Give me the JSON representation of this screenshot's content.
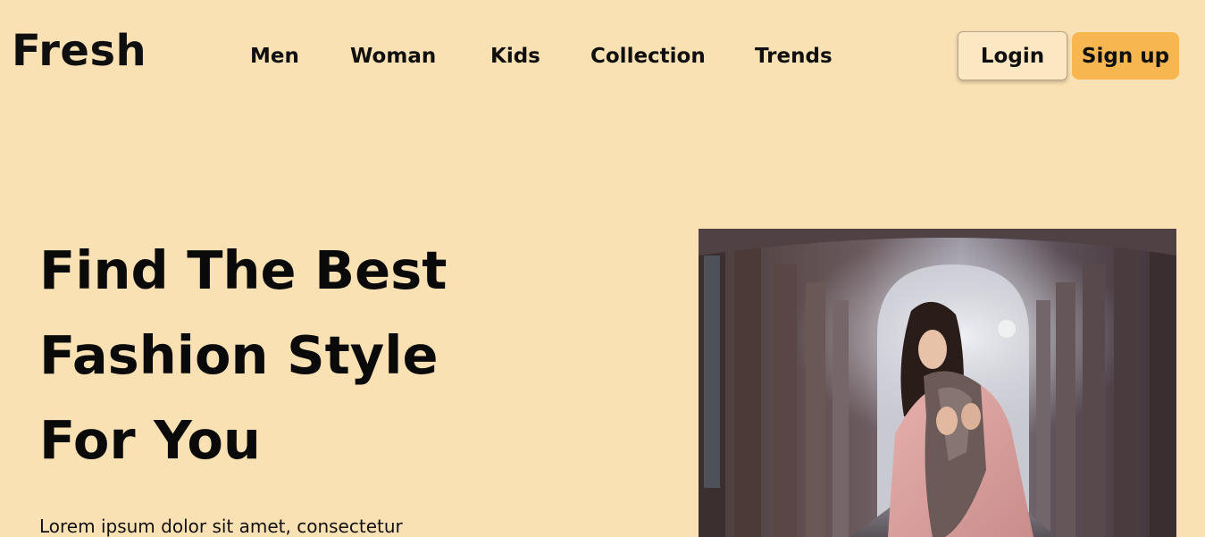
{
  "header": {
    "brand": "Fresh",
    "nav": {
      "men": "Men",
      "woman": "Woman",
      "kids": "Kids",
      "collection": "Collection",
      "trends": "Trends"
    },
    "login_label": "Login",
    "signup_label": "Sign up"
  },
  "hero": {
    "title_lines": [
      "Find The Best",
      "Fashion Style",
      "For You"
    ],
    "description": "Lorem ipsum dolor sit amet, consectetur",
    "image_alt": "woman in pink coat and scarf standing in an arched corridor"
  },
  "colors": {
    "background": "#fae1b3",
    "accent": "#f7b64f",
    "text": "#0f0f0f"
  }
}
